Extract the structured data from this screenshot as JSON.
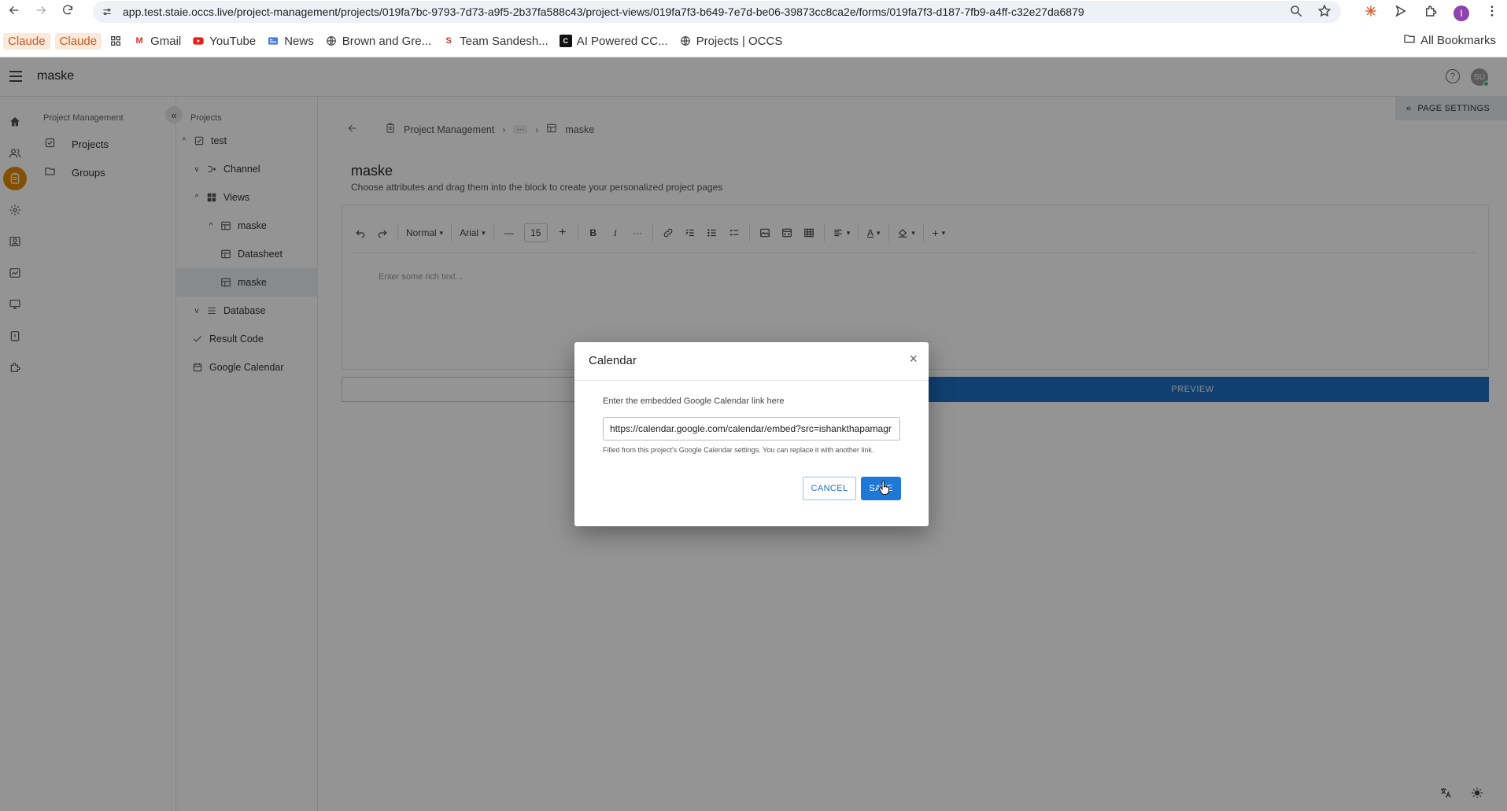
{
  "browser": {
    "url": "app.test.staie.occs.live/project-management/projects/019fa7bc-9793-7d73-a9f5-2b37fa588c43/project-views/019fa7f3-b649-7e7d-be06-39873cc8ca2e/forms/019fa7f3-d187-7fb9-a4ff-c32e27da6879",
    "profile_initial": "I",
    "bookmarks": [
      "Claude",
      "Claude",
      "Gmail",
      "YouTube",
      "News",
      "Brown and Gre...",
      "Team Sandesh...",
      "AI Powered CC...",
      "Projects | OCCS"
    ],
    "all_bookmarks": "All Bookmarks"
  },
  "header": {
    "title": "maske",
    "help": "?",
    "user_initials": "SU"
  },
  "nav_panel": {
    "section": "Project Management",
    "items": [
      {
        "label": "Projects",
        "icon": "checkbox-icon"
      },
      {
        "label": "Groups",
        "icon": "folder-icon"
      }
    ]
  },
  "tree_panel": {
    "section": "Projects",
    "rows": [
      {
        "label": "test",
        "chevron": "^"
      },
      {
        "label": "Channel",
        "chevron": "v"
      },
      {
        "label": "Views",
        "chevron": "^"
      },
      {
        "label": "maske",
        "chevron": "^"
      },
      {
        "label": "Datasheet"
      },
      {
        "label": "maske",
        "selected": true
      },
      {
        "label": "Database",
        "chevron": "v"
      },
      {
        "label": "Result Code"
      },
      {
        "label": "Google Calendar"
      }
    ]
  },
  "main": {
    "page_settings": "PAGE SETTINGS",
    "breadcrumb": [
      "Project Management",
      "···",
      "maske"
    ],
    "title": "maske",
    "subtitle": "Choose attributes and drag them into the block to create your personalized project pages",
    "toolbar": {
      "block_type": "Normal",
      "font": "Arial",
      "font_size": "15",
      "bold": "B",
      "italic": "I",
      "more": "···",
      "text_color": "A",
      "insert": "+"
    },
    "editor_placeholder": "Enter some rich text...",
    "preview_label": "PREVIEW"
  },
  "dialog": {
    "title": "Calendar",
    "close": "×",
    "label": "Enter the embedded Google Calendar link here",
    "input_value": "https://calendar.google.com/calendar/embed?src=ishankthapamagr",
    "help_text": "Filled from this project's Google Calendar settings. You can replace it with another link.",
    "cancel_label": "CANCEL",
    "save_label": "SAVE"
  },
  "colors": {
    "accent": "#1e78d6",
    "rail_active": "#e08a00",
    "overlay": "rgba(0,0,0,0.42)"
  }
}
